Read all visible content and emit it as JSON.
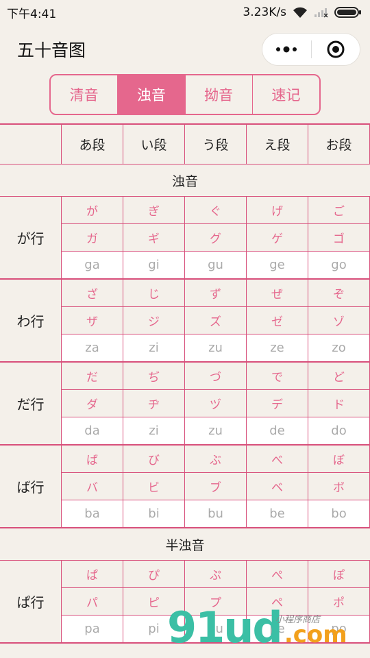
{
  "status_bar": {
    "time": "下午4:41",
    "speed": "3.23K/s"
  },
  "nav": {
    "title": "五十音图"
  },
  "tabs": [
    {
      "label": "清音",
      "active": false
    },
    {
      "label": "浊音",
      "active": true
    },
    {
      "label": "拗音",
      "active": false
    },
    {
      "label": "速记",
      "active": false
    }
  ],
  "table": {
    "columns": [
      "あ段",
      "い段",
      "う段",
      "え段",
      "お段"
    ],
    "sections": [
      {
        "title": "浊音",
        "groups": [
          {
            "label": "が行",
            "hiragana": [
              "が",
              "ぎ",
              "ぐ",
              "げ",
              "ご"
            ],
            "katakana": [
              "ガ",
              "ギ",
              "グ",
              "ゲ",
              "ゴ"
            ],
            "romaji": [
              "ga",
              "gi",
              "gu",
              "ge",
              "go"
            ]
          },
          {
            "label": "わ行",
            "hiragana": [
              "ざ",
              "じ",
              "ず",
              "ぜ",
              "ぞ"
            ],
            "katakana": [
              "ザ",
              "ジ",
              "ズ",
              "ゼ",
              "ゾ"
            ],
            "romaji": [
              "za",
              "zi",
              "zu",
              "ze",
              "zo"
            ]
          },
          {
            "label": "だ行",
            "hiragana": [
              "だ",
              "ぢ",
              "づ",
              "で",
              "ど"
            ],
            "katakana": [
              "ダ",
              "ヂ",
              "ヅ",
              "デ",
              "ド"
            ],
            "romaji": [
              "da",
              "zi",
              "zu",
              "de",
              "do"
            ]
          },
          {
            "label": "ば行",
            "hiragana": [
              "ば",
              "び",
              "ぶ",
              "べ",
              "ぼ"
            ],
            "katakana": [
              "バ",
              "ビ",
              "ブ",
              "ベ",
              "ボ"
            ],
            "romaji": [
              "ba",
              "bi",
              "bu",
              "be",
              "bo"
            ]
          }
        ]
      },
      {
        "title": "半浊音",
        "groups": [
          {
            "label": "ぱ行",
            "hiragana": [
              "ぱ",
              "ぴ",
              "ぷ",
              "ぺ",
              "ぽ"
            ],
            "katakana": [
              "パ",
              "ピ",
              "プ",
              "ペ",
              "ポ"
            ],
            "romaji": [
              "pa",
              "pi",
              "pu",
              "pe",
              "po"
            ]
          }
        ]
      }
    ]
  },
  "watermark": {
    "brand": "91ud",
    "domain": ".com",
    "tagline": "小程序商店"
  },
  "colors": {
    "accent": "#e5678d",
    "background": "#f4f0ea",
    "romaji_text": "#aaaaaa"
  }
}
